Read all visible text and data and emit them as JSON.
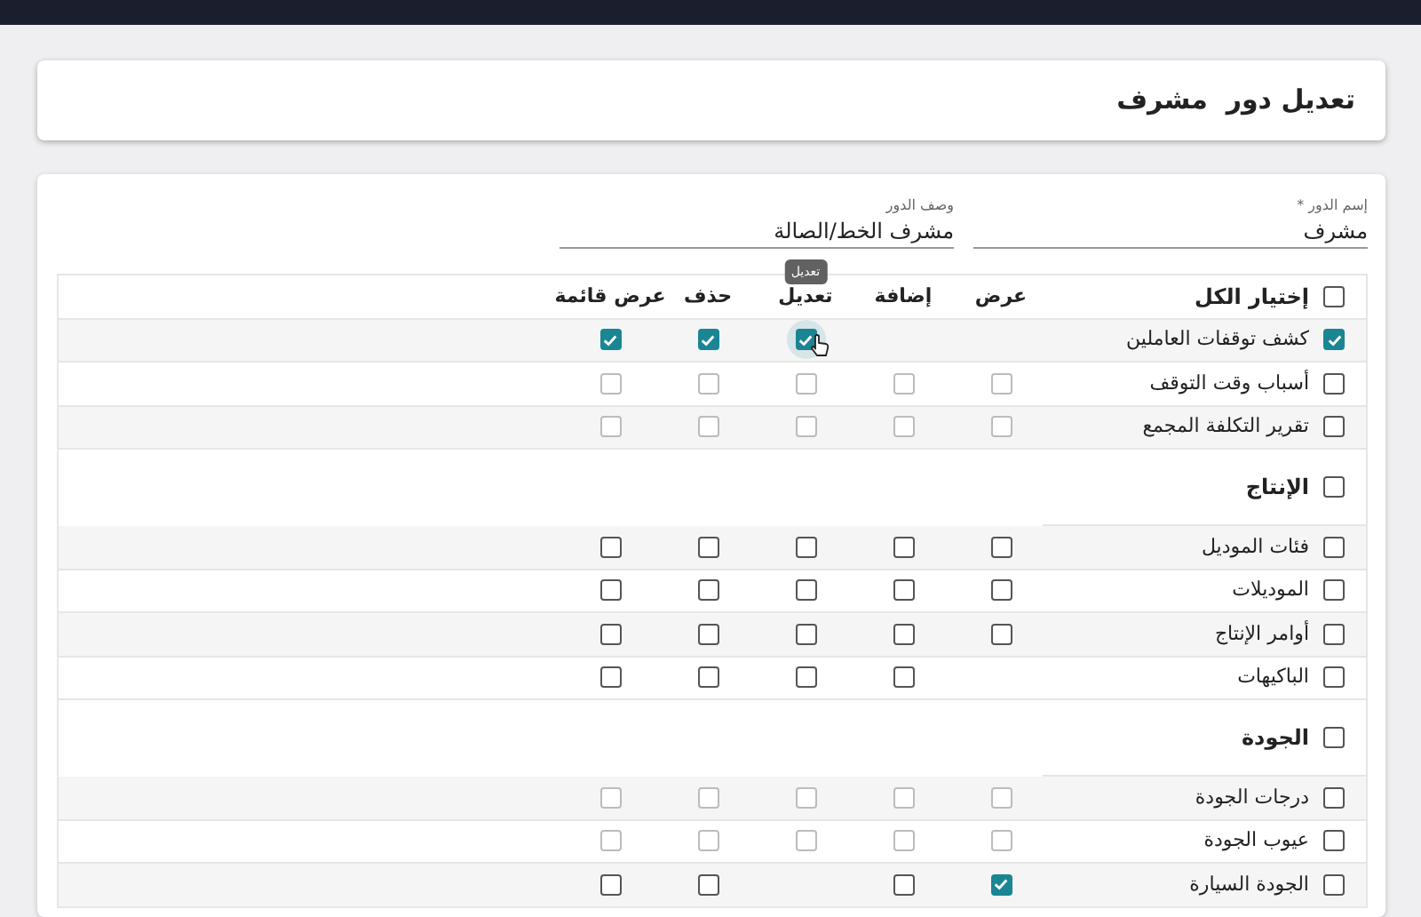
{
  "page_title": "تعديل دور  مشرف",
  "fields": [
    {
      "label": "إسم الدور *",
      "value": "مشرف"
    },
    {
      "label": "وصف الدور",
      "value": "مشرف الخط/الصالة"
    }
  ],
  "permissions": {
    "select_all": {
      "label": "إختيار الكل",
      "checked": false
    },
    "columns": [
      {
        "label": "عرض"
      },
      {
        "label": "إضافة"
      },
      {
        "label": "تعديل",
        "tooltip": "تعديل"
      },
      {
        "label": "حذف"
      },
      {
        "label": "عرض قائمة"
      }
    ],
    "sections": [
      {
        "rows": [
          {
            "label": "كشف توقفات العاملين",
            "checked": true,
            "cells": [
              {
                "kind": "empty"
              },
              {
                "kind": "empty"
              },
              {
                "kind": "checkbox",
                "checked": true,
                "disabled": false,
                "hovered": true
              },
              {
                "kind": "checkbox",
                "checked": true,
                "disabled": false,
                "hovered": false
              },
              {
                "kind": "checkbox",
                "checked": true,
                "disabled": false,
                "hovered": false
              }
            ]
          },
          {
            "label": "أسباب وقت التوقف",
            "checked": false,
            "cells": [
              {
                "kind": "checkbox",
                "checked": false,
                "disabled": true,
                "hovered": false
              },
              {
                "kind": "checkbox",
                "checked": false,
                "disabled": true,
                "hovered": false
              },
              {
                "kind": "checkbox",
                "checked": false,
                "disabled": true,
                "hovered": false
              },
              {
                "kind": "checkbox",
                "checked": false,
                "disabled": true,
                "hovered": false
              },
              {
                "kind": "checkbox",
                "checked": false,
                "disabled": true,
                "hovered": false
              }
            ]
          },
          {
            "label": "تقرير التكلفة المجمع",
            "checked": false,
            "cells": [
              {
                "kind": "checkbox",
                "checked": false,
                "disabled": true,
                "hovered": false
              },
              {
                "kind": "checkbox",
                "checked": false,
                "disabled": true,
                "hovered": false
              },
              {
                "kind": "checkbox",
                "checked": false,
                "disabled": true,
                "hovered": false
              },
              {
                "kind": "checkbox",
                "checked": false,
                "disabled": true,
                "hovered": false
              },
              {
                "kind": "checkbox",
                "checked": false,
                "disabled": true,
                "hovered": false
              }
            ]
          }
        ]
      },
      {
        "title": "الإنتاج",
        "checked": false,
        "rows": [
          {
            "label": "فئات الموديل",
            "checked": false,
            "cells": [
              {
                "kind": "checkbox",
                "checked": false,
                "disabled": false,
                "hovered": false
              },
              {
                "kind": "checkbox",
                "checked": false,
                "disabled": false,
                "hovered": false
              },
              {
                "kind": "checkbox",
                "checked": false,
                "disabled": false,
                "hovered": false
              },
              {
                "kind": "checkbox",
                "checked": false,
                "disabled": false,
                "hovered": false
              },
              {
                "kind": "checkbox",
                "checked": false,
                "disabled": false,
                "hovered": false
              }
            ]
          },
          {
            "label": "الموديلات",
            "checked": false,
            "cells": [
              {
                "kind": "checkbox",
                "checked": false,
                "disabled": false,
                "hovered": false
              },
              {
                "kind": "checkbox",
                "checked": false,
                "disabled": false,
                "hovered": false
              },
              {
                "kind": "checkbox",
                "checked": false,
                "disabled": false,
                "hovered": false
              },
              {
                "kind": "checkbox",
                "checked": false,
                "disabled": false,
                "hovered": false
              },
              {
                "kind": "checkbox",
                "checked": false,
                "disabled": false,
                "hovered": false
              }
            ]
          },
          {
            "label": "أوامر الإنتاج",
            "checked": false,
            "cells": [
              {
                "kind": "checkbox",
                "checked": false,
                "disabled": false,
                "hovered": false
              },
              {
                "kind": "checkbox",
                "checked": false,
                "disabled": false,
                "hovered": false
              },
              {
                "kind": "checkbox",
                "checked": false,
                "disabled": false,
                "hovered": false
              },
              {
                "kind": "checkbox",
                "checked": false,
                "disabled": false,
                "hovered": false
              },
              {
                "kind": "checkbox",
                "checked": false,
                "disabled": false,
                "hovered": false
              }
            ]
          },
          {
            "label": "الباكيهات",
            "checked": false,
            "cells": [
              {
                "kind": "empty"
              },
              {
                "kind": "checkbox",
                "checked": false,
                "disabled": false,
                "hovered": false
              },
              {
                "kind": "checkbox",
                "checked": false,
                "disabled": false,
                "hovered": false
              },
              {
                "kind": "checkbox",
                "checked": false,
                "disabled": false,
                "hovered": false
              },
              {
                "kind": "checkbox",
                "checked": false,
                "disabled": false,
                "hovered": false
              }
            ]
          }
        ]
      },
      {
        "title": "الجودة",
        "checked": false,
        "rows": [
          {
            "label": "درجات الجودة",
            "checked": false,
            "cells": [
              {
                "kind": "checkbox",
                "checked": false,
                "disabled": true,
                "hovered": false
              },
              {
                "kind": "checkbox",
                "checked": false,
                "disabled": true,
                "hovered": false
              },
              {
                "kind": "checkbox",
                "checked": false,
                "disabled": true,
                "hovered": false
              },
              {
                "kind": "checkbox",
                "checked": false,
                "disabled": true,
                "hovered": false
              },
              {
                "kind": "checkbox",
                "checked": false,
                "disabled": true,
                "hovered": false
              }
            ]
          },
          {
            "label": "عيوب الجودة",
            "checked": false,
            "cells": [
              {
                "kind": "checkbox",
                "checked": false,
                "disabled": true,
                "hovered": false
              },
              {
                "kind": "checkbox",
                "checked": false,
                "disabled": true,
                "hovered": false
              },
              {
                "kind": "checkbox",
                "checked": false,
                "disabled": true,
                "hovered": false
              },
              {
                "kind": "checkbox",
                "checked": false,
                "disabled": true,
                "hovered": false
              },
              {
                "kind": "checkbox",
                "checked": false,
                "disabled": true,
                "hovered": false
              }
            ]
          },
          {
            "label": "الجودة السيارة",
            "checked": false,
            "cells": [
              {
                "kind": "checkbox",
                "checked": true,
                "disabled": false,
                "hovered": false
              },
              {
                "kind": "checkbox",
                "checked": false,
                "disabled": false,
                "hovered": false
              },
              {
                "kind": "empty"
              },
              {
                "kind": "checkbox",
                "checked": false,
                "disabled": false,
                "hovered": false
              },
              {
                "kind": "checkbox",
                "checked": false,
                "disabled": false,
                "hovered": false
              }
            ]
          }
        ]
      }
    ]
  }
}
